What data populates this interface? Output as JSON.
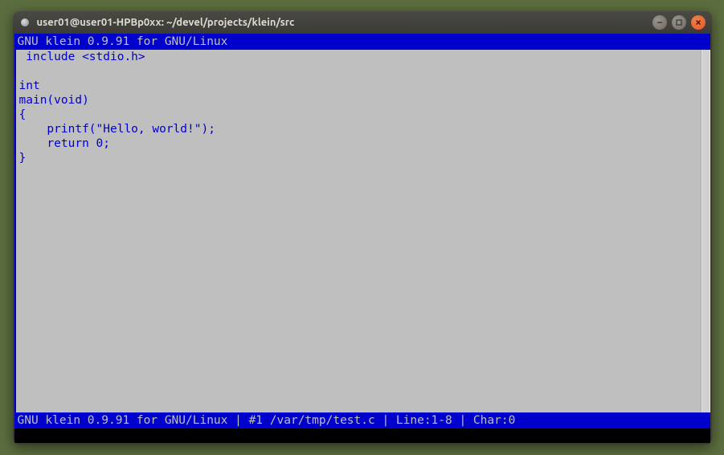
{
  "window": {
    "title": "user01@user01-HPBp0xx: ~/devel/projects/klein/src"
  },
  "editor": {
    "header": "GNU klein 0.9.91 for GNU/Linux",
    "code_lines": [
      " include <stdio.h>",
      "",
      "int",
      "main(void)",
      "{",
      "    printf(\"Hello, world!\");",
      "    return 0;",
      "}"
    ],
    "status": "GNU klein 0.9.91 for GNU/Linux | #1 /var/tmp/test.c | Line:1-8 | Char:0"
  }
}
